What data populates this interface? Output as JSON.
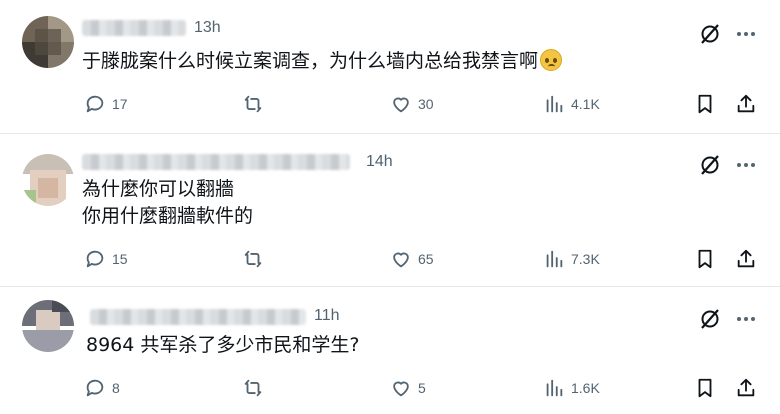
{
  "posts": [
    {
      "time": "13h",
      "lines": [
        "于滕胧案什么时候立案调查，为什么墙内总给我禁言啊"
      ],
      "emoji": "pleading-face-emoji",
      "replies": "17",
      "reposts": "",
      "likes": "30",
      "views": "4.1K"
    },
    {
      "time": "14h",
      "lines": [
        "為什麼你可以翻牆",
        "你用什麼翻牆軟件的"
      ],
      "replies": "15",
      "reposts": "",
      "likes": "65",
      "views": "7.3K"
    },
    {
      "time": "11h",
      "lines": [
        "8964 共军杀了多少市民和学生?"
      ],
      "replies": "8",
      "reposts": "",
      "likes": "5",
      "views": "1.6K"
    }
  ],
  "icons": {
    "reply": "reply-icon",
    "repost": "repost-icon",
    "like": "heart-icon",
    "views": "views-icon",
    "bookmark": "bookmark-icon",
    "share": "share-icon",
    "grok": "grok-icon",
    "more": "more-icon"
  },
  "colors": {
    "text": "#0f1419",
    "secondary": "#536471",
    "divider": "#e6e9ec"
  }
}
